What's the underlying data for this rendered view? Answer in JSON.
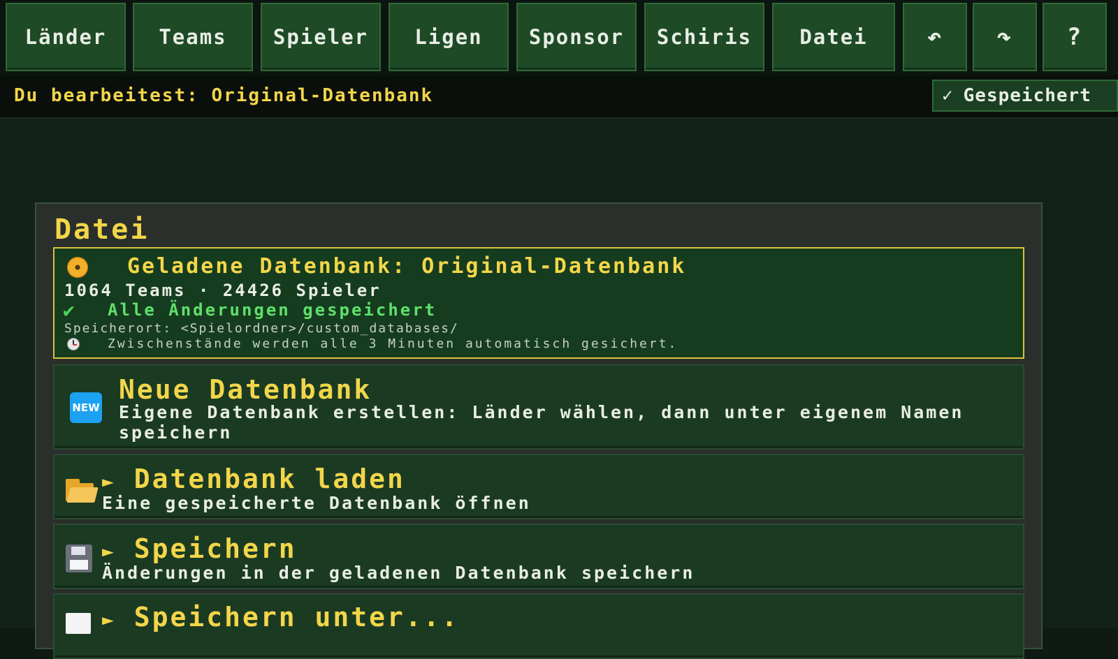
{
  "nav": {
    "items": [
      {
        "label": "Länder",
        "name": "nav-laender"
      },
      {
        "label": "Teams",
        "name": "nav-teams"
      },
      {
        "label": "Spieler",
        "name": "nav-spieler"
      },
      {
        "label": "Ligen",
        "name": "nav-ligen"
      },
      {
        "label": "Sponsor",
        "name": "nav-sponsor"
      },
      {
        "label": "Schiris",
        "name": "nav-schiris"
      },
      {
        "label": "Datei",
        "name": "nav-datei"
      }
    ],
    "undo_icon": "↶",
    "redo_icon": "↷",
    "help_icon": "?"
  },
  "status": {
    "editing_label": "Du bearbeitest: Original-Datenbank",
    "saved_check": "✓",
    "saved_label": "Gespeichert"
  },
  "panel": {
    "title": "Datei",
    "loaded": {
      "title": "Geladene Datenbank: Original-Datenbank",
      "stats": "1064 Teams · 24426 Spieler",
      "saved_check": "✔",
      "saved_text": "Alle Änderungen gespeichert",
      "location": "Speicherort: <Spielordner>/custom_databases/",
      "autosave": "Zwischenstände werden alle 3 Minuten automatisch gesichert."
    },
    "cards": {
      "new": {
        "badge": "NEW",
        "title": "Neue Datenbank",
        "desc_line1": "Eigene Datenbank erstellen: Länder wählen, dann unter eigenem Namen",
        "desc_line2": "speichern"
      },
      "load": {
        "arrow": "►",
        "title": "Datenbank laden",
        "desc": "Eine gespeicherte Datenbank öffnen"
      },
      "save": {
        "arrow": "►",
        "title": "Speichern",
        "desc": "Änderungen in der geladenen Datenbank speichern"
      },
      "save_as": {
        "arrow": "►",
        "title": "Speichern unter..."
      }
    }
  },
  "icons": {
    "disc": "disc-icon",
    "clock": "clock-icon",
    "new": "new-badge-icon",
    "folder": "folder-open-icon",
    "floppy": "floppy-disk-icon",
    "memo": "memo-icon"
  },
  "colors": {
    "accent_yellow": "#f2d64a",
    "nav_green": "#1e4a26",
    "panel_bg": "#2a2f2b",
    "card_bg": "#1b3a22",
    "new_blue": "#1da1f2"
  }
}
